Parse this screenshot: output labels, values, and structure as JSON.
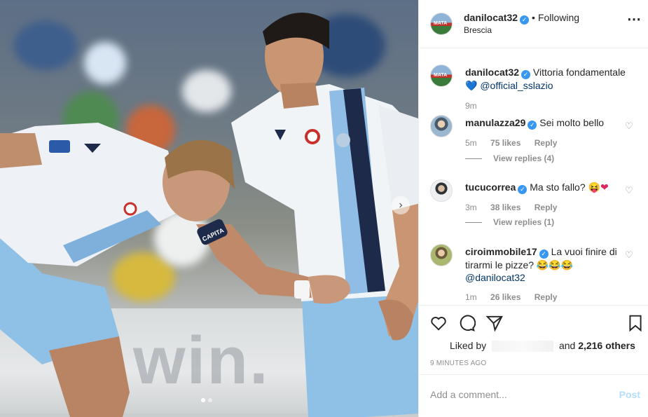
{
  "post": {
    "image_alt": "Lazio players celebrating",
    "banner_text": "win.",
    "jersey_text": "CAPITA"
  },
  "header": {
    "username": "danilocat32",
    "separator": "•",
    "follow_status": "Following",
    "location": "Brescia",
    "more_icon": "⋯"
  },
  "caption": {
    "username": "danilocat32",
    "text": "Vittoria fondamentale",
    "emoji": "💙",
    "mention": "@official_sslazio",
    "time": "9m"
  },
  "comments": [
    {
      "username": "manulazza29",
      "text": "Sei molto bello",
      "time": "5m",
      "likes": "75 likes",
      "reply": "Reply",
      "view_replies": "View replies (4)"
    },
    {
      "username": "tucucorrea",
      "text": "Ma sto fallo? 😝",
      "emoji": "❤",
      "time": "3m",
      "likes": "38 likes",
      "reply": "Reply",
      "view_replies": "View replies (1)"
    },
    {
      "username": "ciroimmobile17",
      "text": "La vuoi finire di tirarmi le pizze? 😂😂😂",
      "mention": "@danilocat32",
      "time": "1m",
      "likes": "26 likes",
      "reply": "Reply"
    }
  ],
  "actions": {
    "liked_by_label": "Liked by",
    "and_label": "and",
    "others_count": "2,216 others",
    "time_ago": "9 MINUTES AGO"
  },
  "add_comment": {
    "placeholder": "Add a comment...",
    "post_label": "Post"
  },
  "colors": {
    "verified": "#3897f0",
    "post_disabled": "#b2dffc",
    "mention": "#003569"
  }
}
